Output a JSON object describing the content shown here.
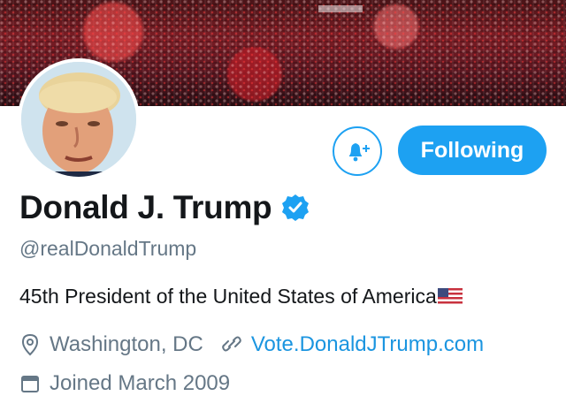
{
  "profile": {
    "display_name": "Donald J. Trump",
    "handle": "@realDonaldTrump",
    "bio": "45th President of the United States of America",
    "location": "Washington, DC",
    "website": "Vote.DonaldJTrump.com",
    "joined": "Joined March 2009",
    "verified": true
  },
  "actions": {
    "follow_label": "Following",
    "notify_icon": "bell-plus-icon"
  },
  "icons": {
    "location": "location-pin-icon",
    "website": "link-icon",
    "joined": "calendar-icon",
    "verified": "verified-badge-icon",
    "flag": "us-flag-icon"
  },
  "colors": {
    "accent": "#1da1f2",
    "link": "#1b95e0",
    "text": "#14171a",
    "muted": "#657786"
  }
}
